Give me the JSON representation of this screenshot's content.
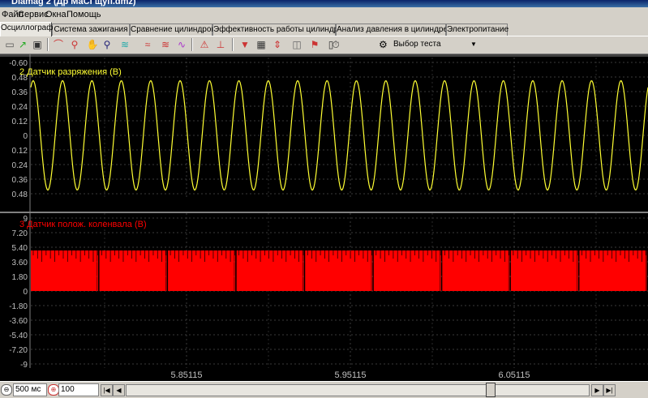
{
  "window": {
    "title": "Diamag 2 (Др МаСГщуп.dmz)"
  },
  "menu": {
    "items": [
      "Файл",
      "Сервис",
      "Окна",
      "Помощь"
    ]
  },
  "tabs": [
    {
      "label": "Осциллограф",
      "active": true
    },
    {
      "label": "Система зажигания",
      "active": false
    },
    {
      "label": "Сравнение цилиндров",
      "active": false
    },
    {
      "label": "Эффективность работы цилиндров",
      "active": false
    },
    {
      "label": "Анализ давления в цилиндре",
      "active": false
    },
    {
      "label": "Электропитание",
      "active": false
    }
  ],
  "toolbar": {
    "icons": [
      "open-icon",
      "save-icon",
      "print-icon",
      "hand-icon",
      "zoom-icon",
      "filter-icon",
      "channels-icon",
      "channel-add-icon",
      "measure-icon",
      "zero-icon",
      "marker-icon",
      "grid-icon",
      "split-icon",
      "flag-icon",
      "copy-icon",
      "auto-icon"
    ],
    "test_select_label": "Выбор теста"
  },
  "channels": [
    {
      "name": "2 Датчик разряжения (В)",
      "color": "#ffff33",
      "y_ticks": [
        "-0.60",
        "0.48",
        "0.36",
        "0.24",
        "0.12",
        "0",
        "0.12",
        "0.24",
        "0.36",
        "0.48"
      ]
    },
    {
      "name": "3 Датчик полож. коленвала (В)",
      "color": "#ff0000",
      "y_ticks": [
        "9",
        "7.20",
        "5.40",
        "3.60",
        "1.80",
        "0",
        "-1.80",
        "-3.60",
        "-5.40",
        "-7.20",
        "-9"
      ]
    }
  ],
  "x_axis": {
    "ticks": [
      "5.85115",
      "5.95115",
      "6.05115"
    ]
  },
  "statusbar": {
    "timebase": "500 мс",
    "amplitude": "100"
  },
  "chart_data": [
    {
      "type": "line",
      "title": "2 Датчик разряжения (В)",
      "x": [
        5.792,
        5.812,
        5.832,
        5.852,
        5.872,
        5.892,
        5.912,
        5.932,
        5.952,
        5.972,
        5.992,
        6.012,
        6.032,
        6.052,
        6.072
      ],
      "series": [
        {
          "name": "2 Датчик разряжения (В)",
          "values": [
            0.45,
            -0.45,
            0.45,
            -0.45,
            0.45,
            -0.45,
            0.45,
            -0.45,
            0.45,
            -0.45,
            0.45,
            -0.45,
            0.45,
            -0.45,
            0.45
          ]
        }
      ],
      "ylim": [
        -0.6,
        0.6
      ],
      "grid": true,
      "cycles_visible": 21
    },
    {
      "type": "line",
      "title": "3 Датчик полож. коленвала (В)",
      "series": [
        {
          "name": "3 Датчик полож. коленвала (В)",
          "values": [
            0,
            5.0,
            0,
            5.0,
            0,
            5.0,
            0,
            5.0
          ]
        }
      ],
      "ylim": [
        -9,
        9
      ],
      "grid": true,
      "gap_markers_visible": 9
    }
  ]
}
